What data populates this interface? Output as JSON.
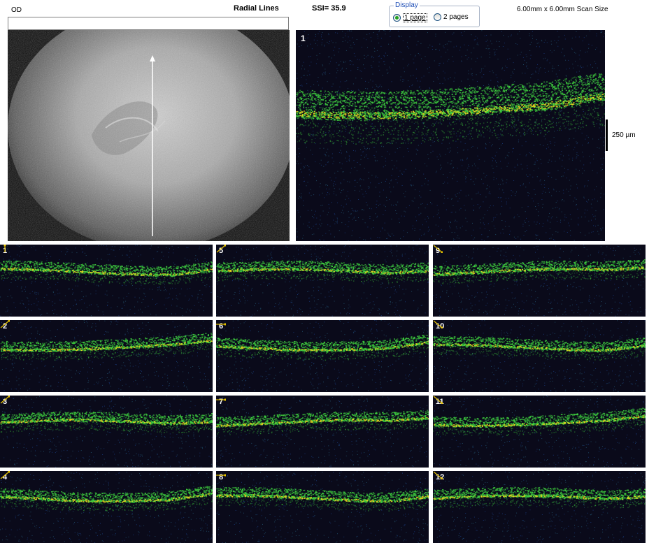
{
  "header": {
    "eye": "OD",
    "scan_type": "Radial Lines",
    "ssi": "SSI= 35.9",
    "scan_size": "6.00mm x 6.00mm Scan Size"
  },
  "display": {
    "legend": "Display",
    "options": [
      "1 page",
      "2 pages"
    ],
    "selected": "1 page"
  },
  "main_scan": {
    "number": "1"
  },
  "scale": {
    "label": "250 µm"
  },
  "thumbnails": [
    {
      "number": "1",
      "arrow": "up"
    },
    {
      "number": "5",
      "arrow": "up-right"
    },
    {
      "number": "9",
      "arrow": "down-right"
    },
    {
      "number": "2",
      "arrow": "up-right"
    },
    {
      "number": "6",
      "arrow": "right"
    },
    {
      "number": "10",
      "arrow": "down-right"
    },
    {
      "number": "3",
      "arrow": "up-right"
    },
    {
      "number": "7",
      "arrow": "right"
    },
    {
      "number": "11",
      "arrow": "down-right"
    },
    {
      "number": "4",
      "arrow": "up-right"
    },
    {
      "number": "8",
      "arrow": "right"
    },
    {
      "number": "12",
      "arrow": "down-right"
    }
  ],
  "colors": {
    "scan_bg": "#0a0a1a",
    "retina_green": "#3fd23f",
    "retina_yellow": "#e6d21e",
    "arrow": "#e6c200"
  }
}
